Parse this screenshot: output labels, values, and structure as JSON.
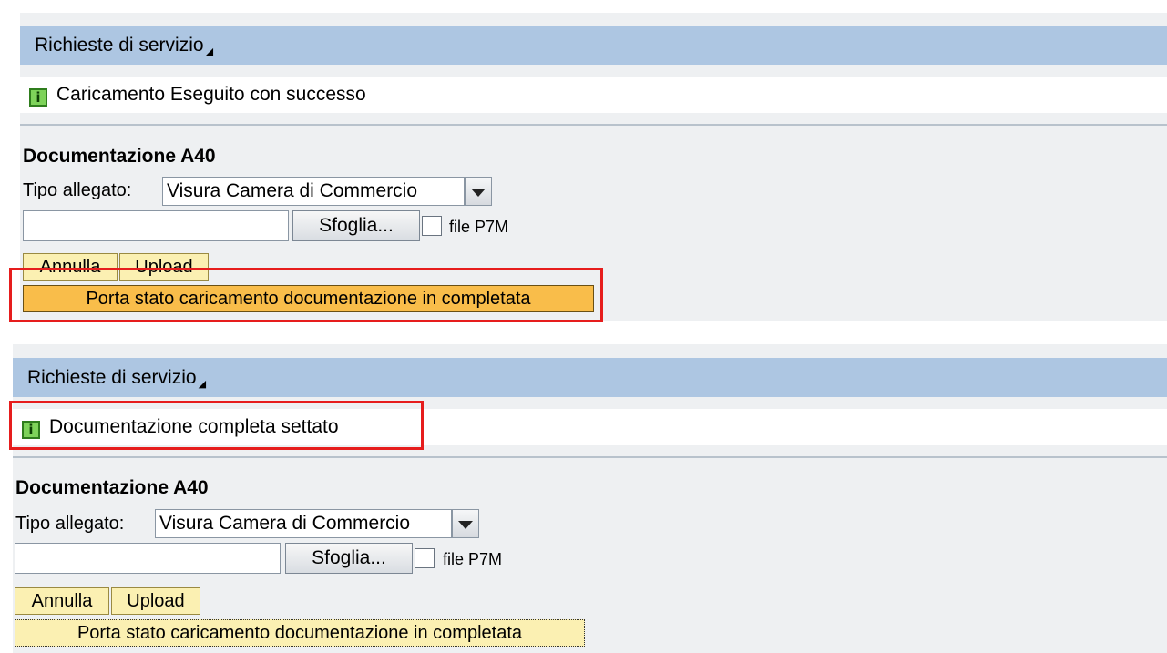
{
  "screen1": {
    "header": {
      "title": "Richieste di servizio"
    },
    "message": {
      "text": "Caricamento Eseguito con successo"
    },
    "section": {
      "title": "Documentazione A40",
      "tipo_label": "Tipo allegato:",
      "tipo_value": "Visura Camera di Commercio",
      "browse_label": "Sfoglia...",
      "file_input_value": "",
      "checkbox_label": "file P7M",
      "checkbox_checked": false,
      "annulla_label": "Annulla",
      "upload_label": "Upload",
      "porta_label": "Porta stato caricamento documentazione in completata"
    }
  },
  "screen2": {
    "header": {
      "title": "Richieste di servizio"
    },
    "message": {
      "text": "Documentazione completa settato"
    },
    "section": {
      "title": "Documentazione A40",
      "tipo_label": "Tipo allegato:",
      "tipo_value": "Visura Camera di Commercio",
      "browse_label": "Sfoglia...",
      "file_input_value": "",
      "checkbox_label": "file P7M",
      "checkbox_checked": false,
      "annulla_label": "Annulla",
      "upload_label": "Upload",
      "porta_label": "Porta stato caricamento documentazione in completata"
    }
  },
  "icons": {
    "info": "info-icon",
    "dropdown": "chevron-down-icon",
    "title_marker": "triangle-icon"
  },
  "colors": {
    "header_bg": "#adc6e2",
    "highlight": "#e61d1d",
    "button_bg": "#fbf0b2",
    "active_button_bg": "#f9bd4a",
    "info_icon": "#7ed35a"
  }
}
